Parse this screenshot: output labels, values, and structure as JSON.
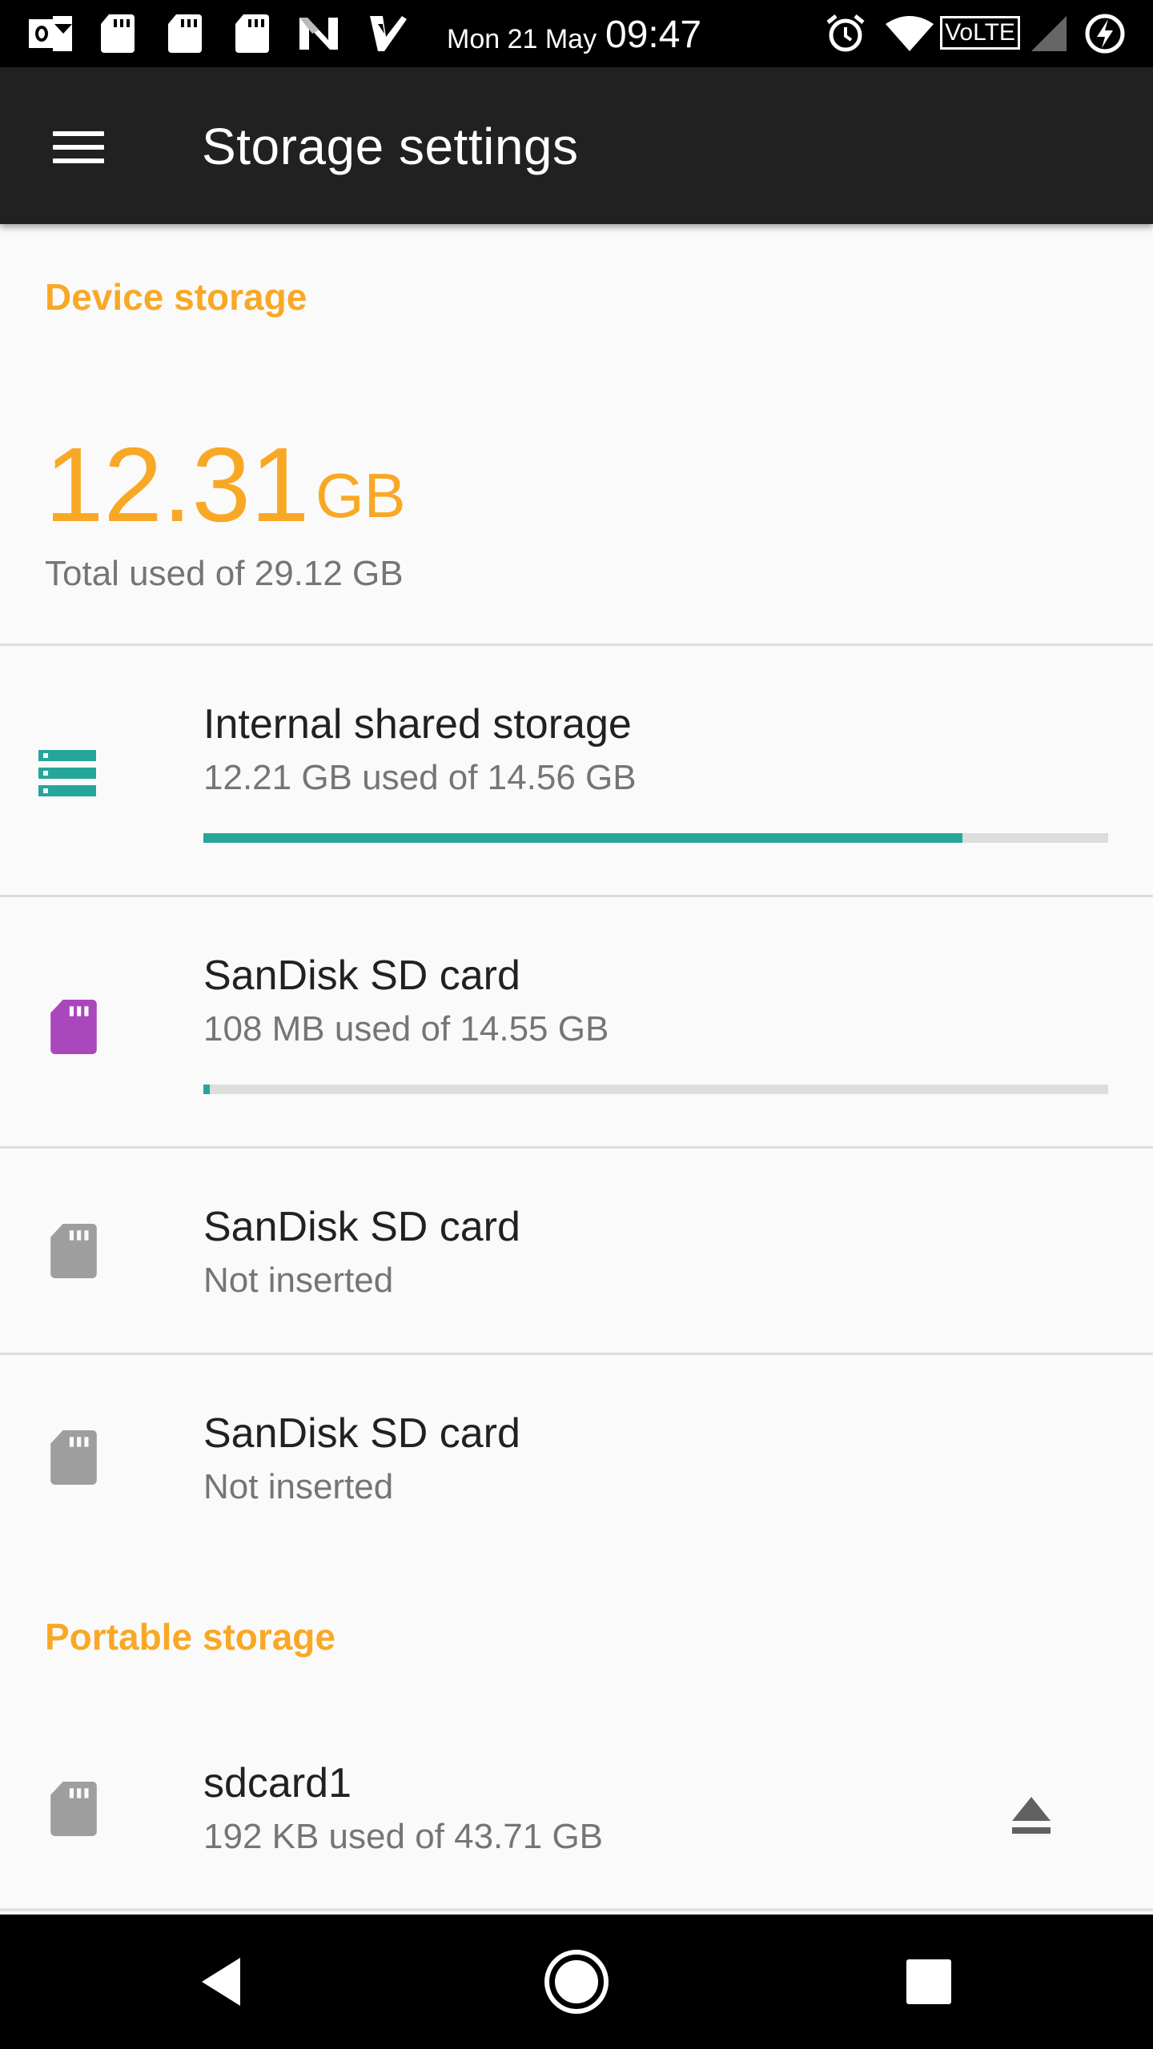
{
  "status_bar": {
    "date": "Mon 21 May",
    "time": "09:47",
    "icons": [
      "outlook-icon",
      "sd-card-icon",
      "sd-card-icon",
      "sd-card-icon",
      "n-app-icon",
      "check-app-icon",
      "alarm-icon",
      "wifi-icon",
      "volte-icon",
      "signal-icon",
      "battery-charging-icon"
    ],
    "volte_label": "VoLTE"
  },
  "app_bar": {
    "title": "Storage settings",
    "menu_icon": "menu-icon"
  },
  "device_storage": {
    "header": "Device storage",
    "used_value": "12.31",
    "used_unit": "GB",
    "total_text": "Total used of 29.12 GB"
  },
  "items": [
    {
      "title": "Internal shared storage",
      "subtitle": "12.21 GB used of 14.56 GB",
      "icon": "storage-icon",
      "progress": 0.8386,
      "color": "#26a69a"
    },
    {
      "title": "SanDisk SD card",
      "subtitle": "108 MB used of 14.55 GB",
      "icon": "sd-card-icon",
      "progress": 0.0072,
      "color": "#ab47bc"
    },
    {
      "title": "SanDisk SD card",
      "subtitle": "Not inserted",
      "icon": "sd-card-icon",
      "color": "#9e9e9e"
    },
    {
      "title": "SanDisk SD card",
      "subtitle": "Not inserted",
      "icon": "sd-card-icon",
      "color": "#9e9e9e"
    }
  ],
  "portable_storage": {
    "header": "Portable storage",
    "items": [
      {
        "title": "sdcard1",
        "subtitle": "192 KB used of 43.71 GB",
        "icon": "sd-card-icon",
        "action_icon": "eject-icon",
        "color": "#9e9e9e"
      }
    ]
  },
  "nav_bar": {
    "icons": [
      "back-icon",
      "home-icon",
      "recents-icon"
    ]
  },
  "colors": {
    "accent": "#f9a825",
    "app_bar": "#212121",
    "teal": "#26a69a",
    "purple": "#ab47bc"
  }
}
